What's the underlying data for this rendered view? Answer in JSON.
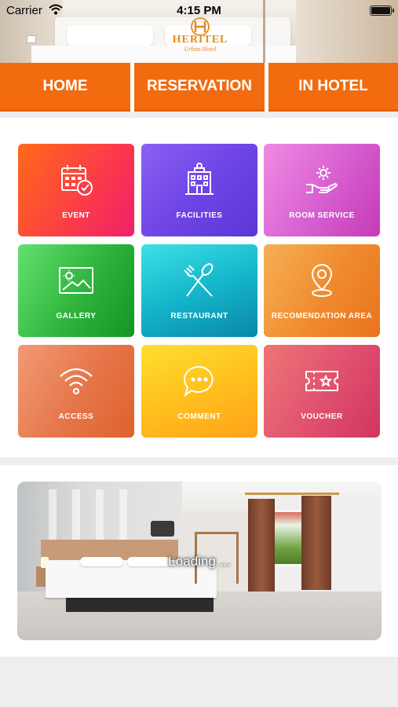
{
  "status_bar": {
    "carrier": "Carrier",
    "time": "4:15 PM",
    "battery_level": 1.0
  },
  "header": {
    "logo_text": "HERITEL",
    "logo_tagline": "Urban Hotel",
    "logo_color": "#e38b1e"
  },
  "nav": {
    "accent_color": "#f26b0f",
    "tabs": [
      {
        "label": "HOME"
      },
      {
        "label": "RESERVATION"
      },
      {
        "label": "IN HOTEL"
      }
    ]
  },
  "menu": {
    "tiles": [
      {
        "label": "EVENT",
        "icon": "calendar-check-icon"
      },
      {
        "label": "FACILITIES",
        "icon": "hotel-building-icon"
      },
      {
        "label": "ROOM SERVICE",
        "icon": "hand-gear-icon"
      },
      {
        "label": "GALLERY",
        "icon": "image-icon"
      },
      {
        "label": "RESTAURANT",
        "icon": "fork-spoon-icon"
      },
      {
        "label": "RECOMENDATION AREA",
        "icon": "map-pin-icon"
      },
      {
        "label": "ACCESS",
        "icon": "wifi-icon"
      },
      {
        "label": "COMMENT",
        "icon": "chat-bubble-icon"
      },
      {
        "label": "VOUCHER",
        "icon": "ticket-star-icon"
      }
    ]
  },
  "banner": {
    "loading_text": "Loading ..."
  }
}
